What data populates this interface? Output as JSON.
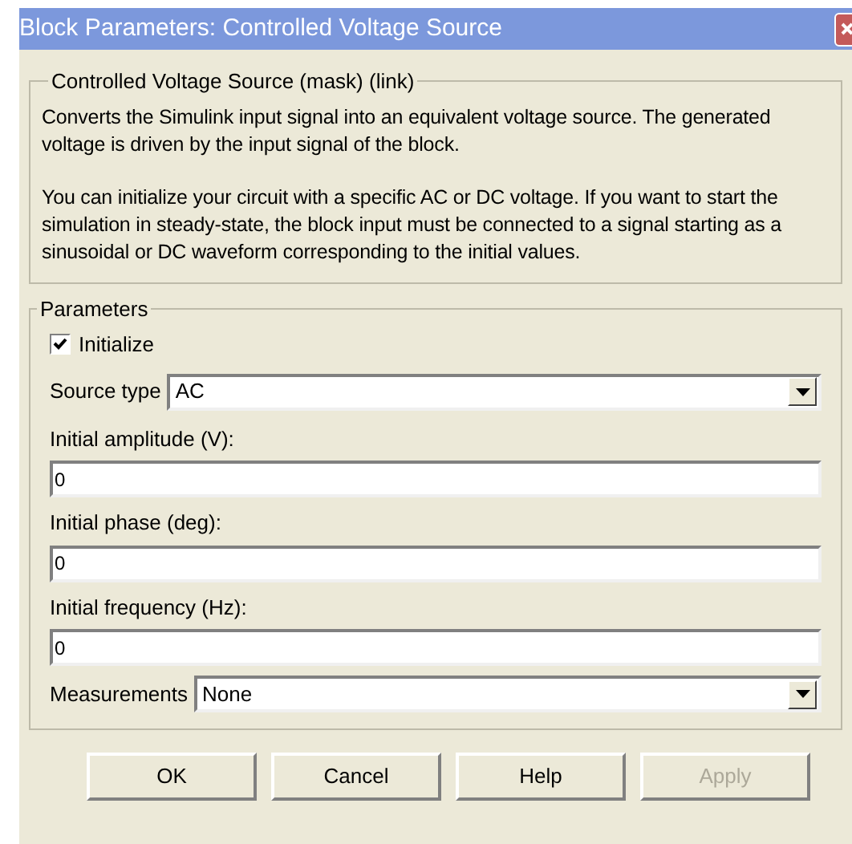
{
  "window": {
    "title": "Block Parameters: Controlled Voltage Source"
  },
  "description": {
    "title": "Controlled Voltage Source (mask) (link)",
    "paragraphs": [
      "Converts the Simulink input signal into an equivalent voltage source. The generated voltage is driven by the input signal of the block.",
      "You can initialize your circuit with a specific AC or DC voltage. If you want to start the simulation in steady-state, the block input must be connected to a signal starting as a sinusoidal or DC waveform corresponding to the initial values."
    ]
  },
  "parameters": {
    "title": "Parameters",
    "items": [
      {
        "kind": "checkbox",
        "label": "Initialize",
        "checked": true
      },
      {
        "kind": "dropdown",
        "label": "Source type",
        "value": "AC"
      },
      {
        "kind": "text",
        "label": "Initial amplitude (V):",
        "value": "0"
      },
      {
        "kind": "text",
        "label": "Initial phase (deg):",
        "value": "0"
      },
      {
        "kind": "text",
        "label": "Initial frequency (Hz):",
        "value": "0"
      },
      {
        "kind": "dropdown",
        "label": "Measurements",
        "value": "None"
      }
    ]
  },
  "buttons": [
    {
      "label": "OK",
      "disabled": false
    },
    {
      "label": "Cancel",
      "disabled": false
    },
    {
      "label": "Help",
      "disabled": false
    },
    {
      "label": "Apply",
      "disabled": true
    }
  ]
}
